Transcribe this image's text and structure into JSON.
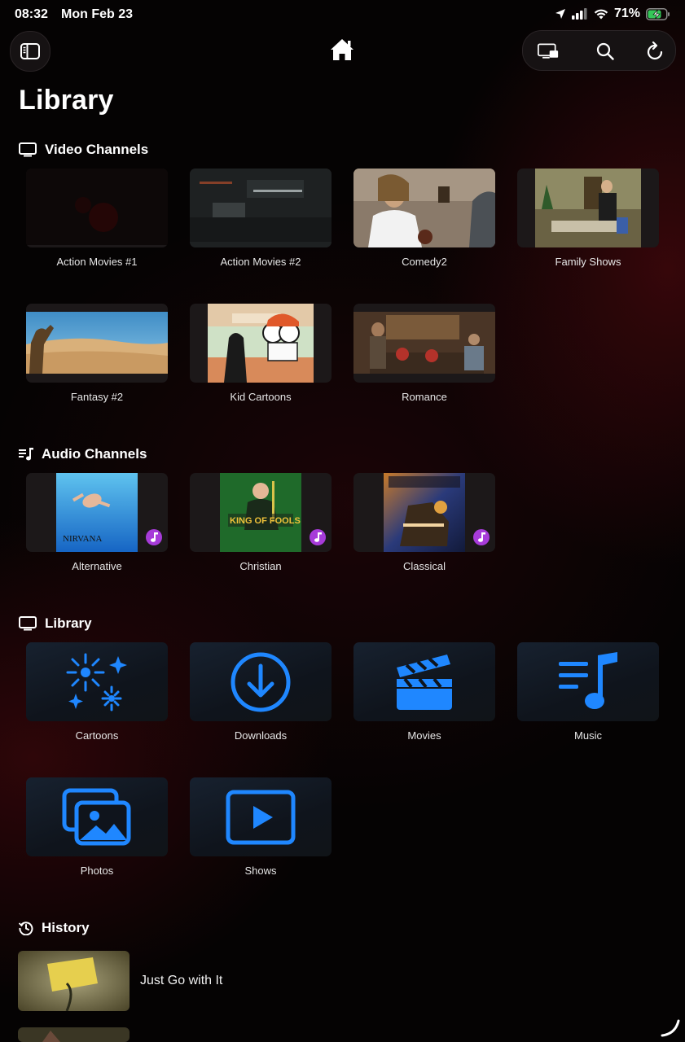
{
  "status_bar": {
    "time": "08:32",
    "date": "Mon Feb 23",
    "battery": "71%"
  },
  "page": {
    "title": "Library"
  },
  "icons": {
    "sidebar": "sidebar-toggle-icon",
    "home": "house-icon",
    "cast": "screen-cast-icon",
    "search": "magnifier-icon",
    "refresh": "refresh-icon",
    "tv": "tv-icon",
    "audio": "music-list-icon",
    "history": "clock-history-icon",
    "note": "music-note-icon",
    "accent_color": "#1f87ff",
    "badge_color": "#a73bd9"
  },
  "video_channels": {
    "header": "Video Channels",
    "items": [
      {
        "label": "Action Movies #1"
      },
      {
        "label": "Action Movies #2"
      },
      {
        "label": "Comedy2"
      },
      {
        "label": "Family Shows"
      },
      {
        "label": "Fantasy #2"
      },
      {
        "label": "Kid Cartoons"
      },
      {
        "label": "Romance"
      }
    ]
  },
  "audio_channels": {
    "header": "Audio Channels",
    "items": [
      {
        "label": "Alternative"
      },
      {
        "label": "Christian"
      },
      {
        "label": "Classical"
      }
    ]
  },
  "library": {
    "header": "Library",
    "items": [
      {
        "label": "Cartoons",
        "icon": "sparkles-icon"
      },
      {
        "label": "Downloads",
        "icon": "download-circle-icon"
      },
      {
        "label": "Movies",
        "icon": "clapperboard-icon"
      },
      {
        "label": "Music",
        "icon": "music-list-icon"
      },
      {
        "label": "Photos",
        "icon": "photos-icon"
      },
      {
        "label": "Shows",
        "icon": "play-rectangle-icon"
      }
    ]
  },
  "history": {
    "header": "History",
    "items": [
      {
        "title": "Just Go with It"
      }
    ]
  }
}
